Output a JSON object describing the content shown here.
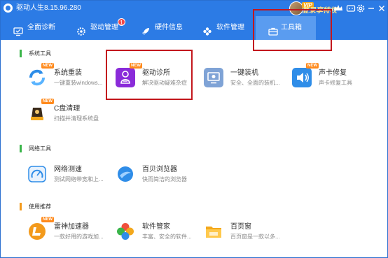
{
  "app": {
    "title": "驱动人生8.15.96.280"
  },
  "titlebar": {
    "vip_badge": "VIP",
    "vip_label": "登录享特权"
  },
  "nav": {
    "tabs": [
      {
        "label": "全面诊断"
      },
      {
        "label": "驱动管理",
        "badge": "1"
      },
      {
        "label": "硬件信息"
      },
      {
        "label": "软件管理"
      },
      {
        "label": "工具箱"
      }
    ],
    "active_tab": "工具箱"
  },
  "sections": [
    {
      "title": "系统工具",
      "accent": "#3ab54a",
      "tools": [
        {
          "name": "系统重装",
          "desc": "一键重装windows...",
          "new": "NEW",
          "icon": "system-reinstall-icon"
        },
        {
          "name": "驱动诊所",
          "desc": "解决驱动疑难杂症",
          "new": "NEW",
          "icon": "driver-clinic-icon"
        },
        {
          "name": "一键装机",
          "desc": "安全、全面的装机...",
          "icon": "one-click-install-icon"
        },
        {
          "name": "声卡修复",
          "desc": "声卡修复工具",
          "new": "NEW",
          "icon": "sound-card-icon"
        },
        {
          "name": "C盘清理",
          "desc": "扫描并清理系统盘",
          "new": "NEW",
          "icon": "disk-clean-icon"
        }
      ]
    },
    {
      "title": "网络工具",
      "accent": "#3ab54a",
      "tools": [
        {
          "name": "网络测速",
          "desc": "测试网络带宽和上...",
          "icon": "speed-test-icon"
        },
        {
          "name": "百贝浏览器",
          "desc": "快而简洁的浏览器",
          "icon": "browser-icon"
        }
      ]
    },
    {
      "title": "使用推荐",
      "accent": "#f39a1c",
      "tools": [
        {
          "name": "雷神加速器",
          "desc": "一款好用的游戏加...",
          "new": "NEW",
          "icon": "accelerator-icon"
        },
        {
          "name": "软件管家",
          "desc": "丰富、安全的软件...",
          "icon": "software-manager-icon"
        },
        {
          "name": "百页窗",
          "desc": "百页窗是一款以多...",
          "icon": "folder-window-icon"
        }
      ]
    }
  ]
}
